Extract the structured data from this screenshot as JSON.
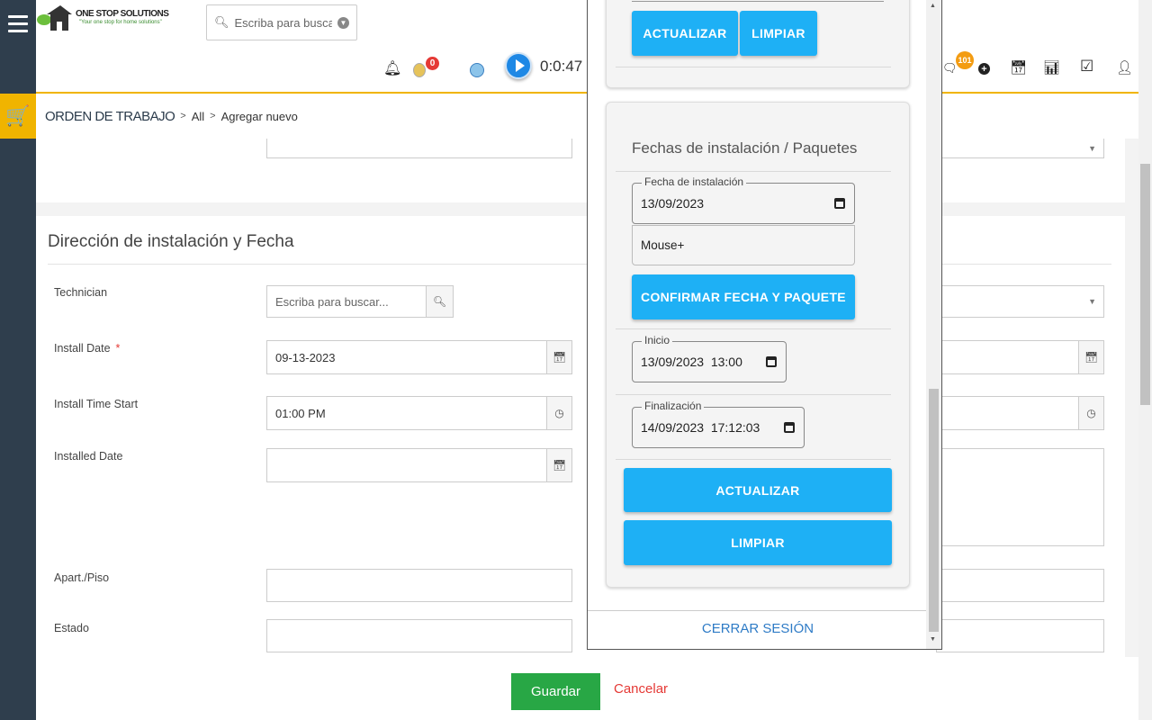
{
  "brand": {
    "name": "ONE STOP SOLUTIONS",
    "tagline": "\"Your one stop for home solutions\""
  },
  "header": {
    "search_placeholder": "Escriba para buscar",
    "notification_badge": "0",
    "chat_badge": "101",
    "timer": "0:0:47"
  },
  "breadcrumb": {
    "main": "ORDEN DE TRABAJO",
    "level1": "All",
    "level2": "Agregar nuevo"
  },
  "section": {
    "title": "Dirección de instalación y Fecha"
  },
  "form": {
    "technician_label": "Technician",
    "technician_placeholder": "Escriba para buscar...",
    "install_date_label": "Install Date",
    "install_date_required": "*",
    "install_date_value": "09-13-2023",
    "install_time_label": "Install Time Start",
    "install_time_value": "01:00 PM",
    "installed_date_label": "Installed Date",
    "apart_label": "Apart./Piso",
    "estado_label": "Estado"
  },
  "actions": {
    "save": "Guardar",
    "cancel": "Cancelar"
  },
  "panel": {
    "top_update": "ACTUALIZAR",
    "top_clear": "LIMPIAR",
    "card_title": "Fechas de instalación / Paquetes",
    "install_date_legend": "Fecha de instalación",
    "install_date_value": "13/09/2023",
    "package_value": "Mouse+",
    "confirm_btn": "CONFIRMAR FECHA Y PAQUETE",
    "start_legend": "Inicio",
    "start_value": "13/09/2023  13:00",
    "end_legend": "Finalización",
    "end_value": "14/09/2023  17:12:03",
    "update_btn": "ACTUALIZAR",
    "clear_btn": "LIMPIAR",
    "logout": "CERRAR SESIÓN"
  },
  "colors": {
    "accent": "#f0b400",
    "primary_button": "#1eb0f5",
    "save": "#28a745",
    "sidebar": "#2f3e4d"
  }
}
